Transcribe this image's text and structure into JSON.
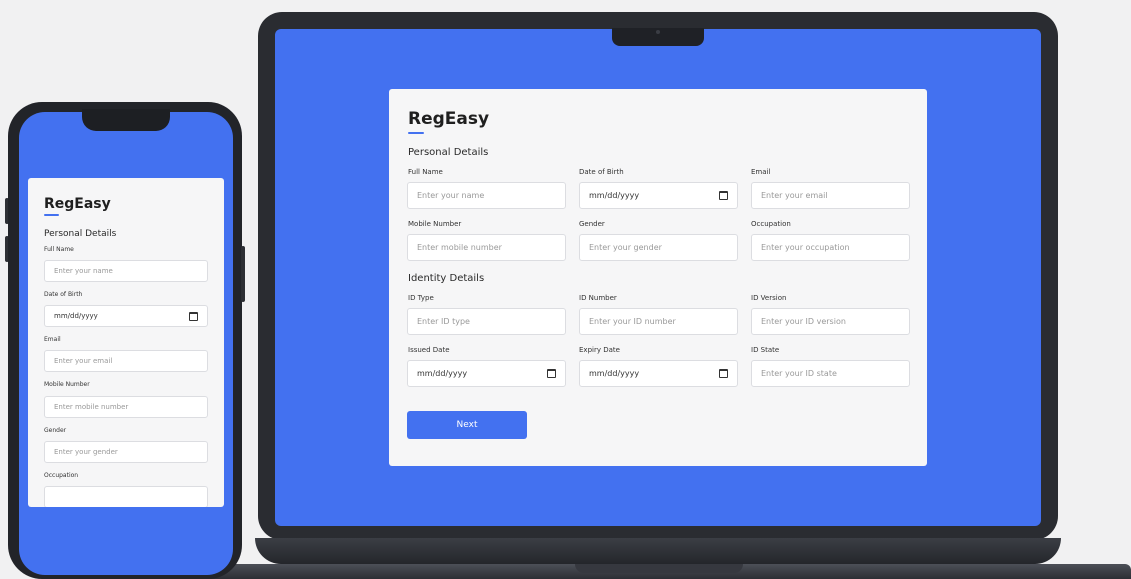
{
  "app": {
    "brand": "RegEasy"
  },
  "laptop": {
    "personal": {
      "title": "Personal Details",
      "fields": [
        {
          "label": "Full Name",
          "placeholder": "Enter your name"
        },
        {
          "label": "Date of Birth",
          "value": "mm/dd/yyyy"
        },
        {
          "label": "Email",
          "placeholder": "Enter your email"
        },
        {
          "label": "Mobile Number",
          "placeholder": "Enter mobile number"
        },
        {
          "label": "Gender",
          "placeholder": "Enter your gender"
        },
        {
          "label": "Occupation",
          "placeholder": "Enter your occupation"
        }
      ]
    },
    "identity": {
      "title": "Identity Details",
      "fields": [
        {
          "label": "ID Type",
          "placeholder": "Enter ID type"
        },
        {
          "label": "ID Number",
          "placeholder": "Enter your ID number"
        },
        {
          "label": "ID Version",
          "placeholder": "Enter your ID version"
        },
        {
          "label": "Issued Date",
          "value": "mm/dd/yyyy"
        },
        {
          "label": "Expiry Date",
          "value": "mm/dd/yyyy"
        },
        {
          "label": "ID State",
          "placeholder": "Enter your ID state"
        }
      ]
    },
    "next_label": "Next"
  },
  "phone": {
    "personal_title": "Personal Details",
    "fields": [
      {
        "label": "Full Name",
        "placeholder": "Enter your name"
      },
      {
        "label": "Date of Birth",
        "value": "mm/dd/yyyy"
      },
      {
        "label": "Email",
        "placeholder": "Enter your email"
      },
      {
        "label": "Mobile Number",
        "placeholder": "Enter mobile number"
      },
      {
        "label": "Gender",
        "placeholder": "Enter your gender"
      },
      {
        "label": "Occupation",
        "placeholder": ""
      }
    ]
  },
  "colors": {
    "accent": "#4371f0",
    "card": "#f6f6f7",
    "device": "#2a2c31"
  }
}
